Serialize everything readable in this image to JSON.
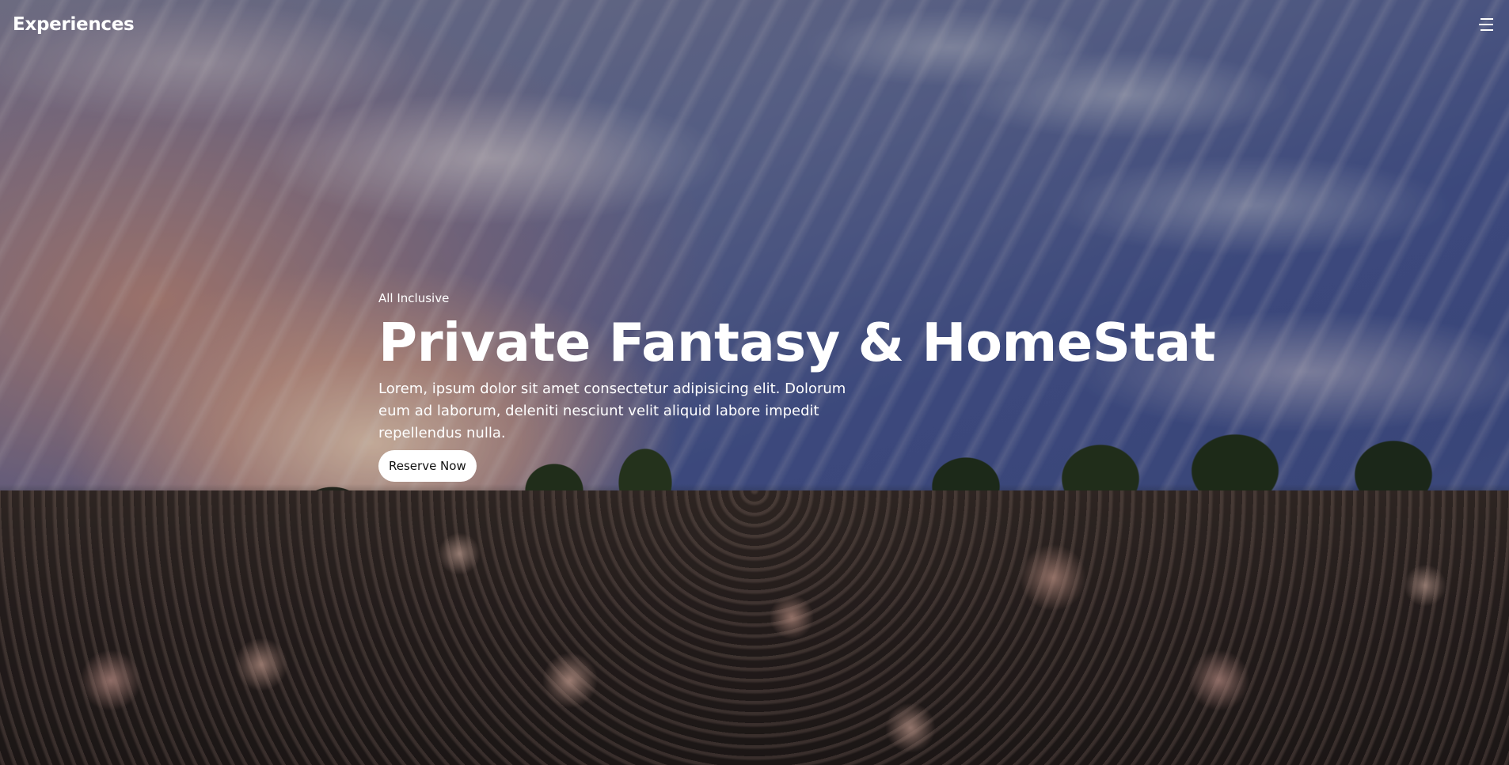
{
  "header": {
    "brand": "Experiences",
    "menu_icon": "hamburger-menu-icon"
  },
  "hero": {
    "background": "sunset-dandelion-field-photo",
    "eyebrow": "All Inclusive",
    "headline": "Private Fantasy & HomeStat",
    "description": "Lorem, ipsum dolor sit amet consectetur adipisicing elit. Dolorum eum ad laborum, deleniti nesciunt velit aliquid labore impedit repellendus nulla.",
    "cta_label": "Reserve Now"
  },
  "colors": {
    "text": "#ffffff",
    "button_bg": "#ffffff",
    "button_text": "#111111"
  }
}
